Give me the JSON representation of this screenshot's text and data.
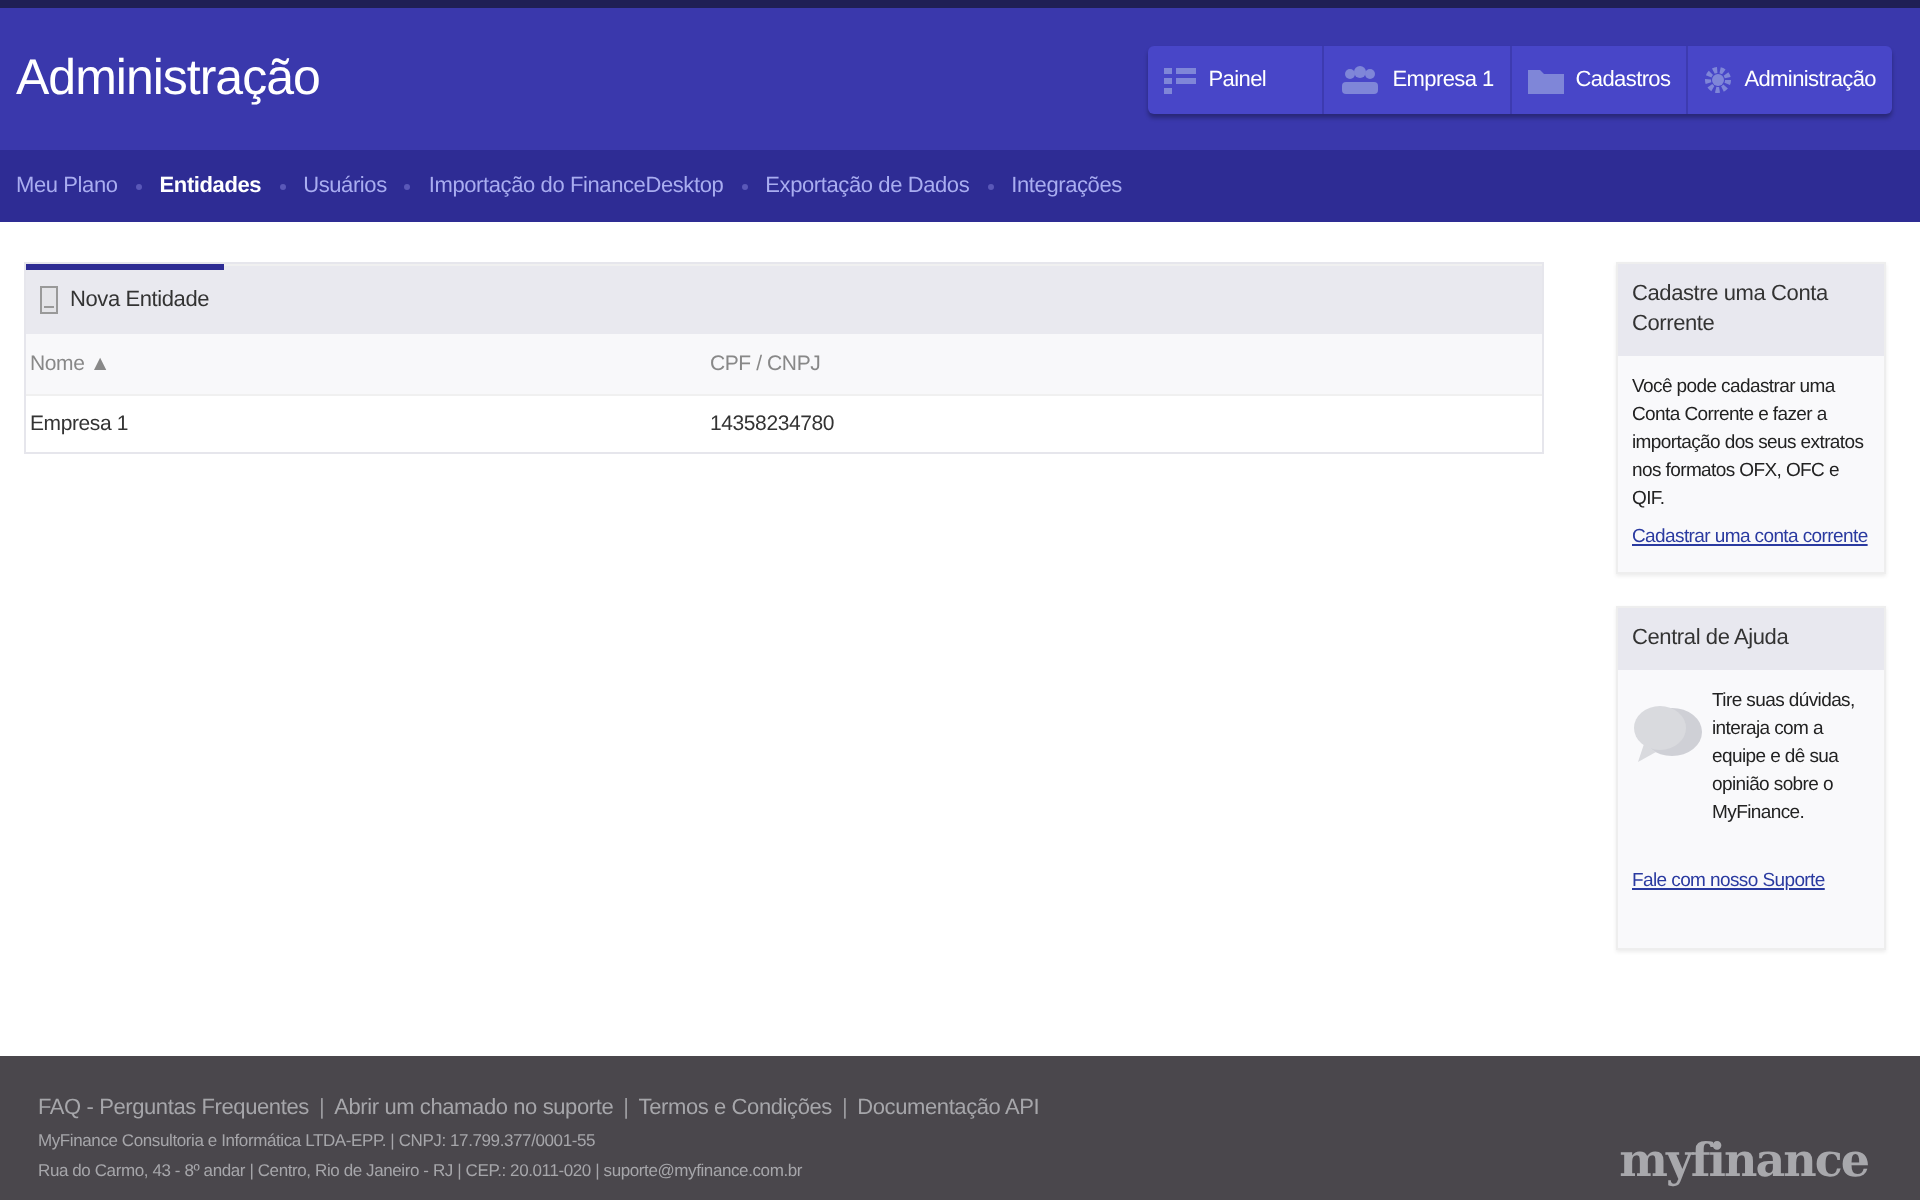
{
  "header": {
    "title": "Administração",
    "buttons": [
      {
        "label": "Painel"
      },
      {
        "label": "Empresa 1"
      },
      {
        "label": "Cadastros"
      },
      {
        "label": "Administração"
      }
    ]
  },
  "nav": [
    {
      "label": "Meu Plano",
      "selected": false
    },
    {
      "label": "Entidades",
      "selected": true
    },
    {
      "label": "Usuários",
      "selected": false
    },
    {
      "label": "Importação do FinanceDesktop",
      "selected": false
    },
    {
      "label": "Exportação de Dados",
      "selected": false
    },
    {
      "label": "Integrações",
      "selected": false
    }
  ],
  "toolbar": {
    "button": "Nova Entidade"
  },
  "table": {
    "columns": [
      "Nome ▲",
      "CPF / CNPJ"
    ],
    "rows": [
      [
        "Empresa 1",
        "14358234780"
      ]
    ]
  },
  "sidebar": [
    {
      "kind": "text",
      "title": "Cadastre uma Conta Corrente",
      "text": "Você pode cadastrar uma Conta Corrente e fazer a importação dos seus extratos nos formatos OFX, OFC e QIF.",
      "link": "Cadastrar uma conta corrente"
    },
    {
      "kind": "chat",
      "title": "Central de Ajuda",
      "text": "Tire suas dúvidas, interaja com a equipe e dê sua opinião sobre o MyFinance.",
      "link": "Fale com nosso Suporte"
    }
  ],
  "footer": {
    "links": [
      {
        "kind": "link",
        "text": "FAQ - Perguntas Frequentes"
      },
      {
        "kind": "sep",
        "text": "|"
      },
      {
        "kind": "link",
        "text": "Abrir um chamado no suporte"
      },
      {
        "kind": "sep",
        "text": "|"
      },
      {
        "kind": "link",
        "text": "Termos e Condições"
      },
      {
        "kind": "sep",
        "text": "|"
      },
      {
        "kind": "link",
        "text": "Documentação API"
      }
    ],
    "company": "MyFinance Consultoria e Informática LTDA-EPP. | CNPJ: 17.799.377/0001-55",
    "address": "Rua do Carmo, 43 - 8º andar | Centro, Rio de Janeiro - RJ | CEP.: 20.011-020 | suporte@myfinance.com.br",
    "logo": "myfinance"
  }
}
